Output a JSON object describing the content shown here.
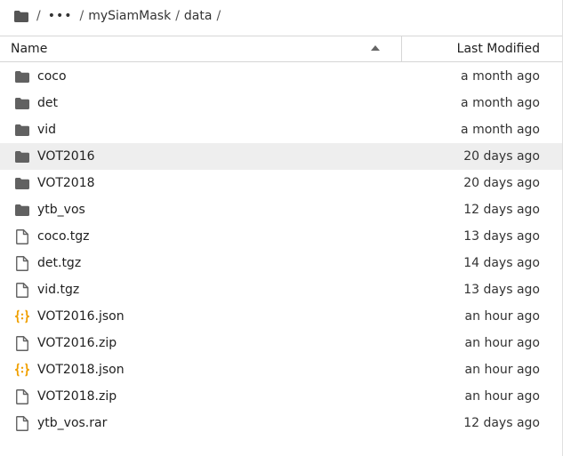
{
  "breadcrumb": {
    "home_sep": "/",
    "more": "•••",
    "more_sep": "/",
    "path1": "mySiamMask",
    "path1_sep": "/",
    "path2": "data",
    "path2_sep": "/"
  },
  "header": {
    "name": "Name",
    "last_modified": "Last Modified"
  },
  "colors": {
    "folder": "#616161",
    "json_icon": "#f0a000",
    "selected_row": "#eeeeee"
  },
  "files": [
    {
      "name": "coco",
      "modified": "a month ago",
      "icon": "folder-icon"
    },
    {
      "name": "det",
      "modified": "a month ago",
      "icon": "folder-icon"
    },
    {
      "name": "vid",
      "modified": "a month ago",
      "icon": "folder-icon"
    },
    {
      "name": "VOT2016",
      "modified": "20 days ago",
      "icon": "folder-icon",
      "selected": true
    },
    {
      "name": "VOT2018",
      "modified": "20 days ago",
      "icon": "folder-icon"
    },
    {
      "name": "ytb_vos",
      "modified": "12 days ago",
      "icon": "folder-icon"
    },
    {
      "name": "coco.tgz",
      "modified": "13 days ago",
      "icon": "file-icon"
    },
    {
      "name": "det.tgz",
      "modified": "14 days ago",
      "icon": "file-icon"
    },
    {
      "name": "vid.tgz",
      "modified": "13 days ago",
      "icon": "file-icon"
    },
    {
      "name": "VOT2016.json",
      "modified": "an hour ago",
      "icon": "json-icon"
    },
    {
      "name": "VOT2016.zip",
      "modified": "an hour ago",
      "icon": "file-icon"
    },
    {
      "name": "VOT2018.json",
      "modified": "an hour ago",
      "icon": "json-icon"
    },
    {
      "name": "VOT2018.zip",
      "modified": "an hour ago",
      "icon": "file-icon"
    },
    {
      "name": "ytb_vos.rar",
      "modified": "12 days ago",
      "icon": "file-icon"
    }
  ]
}
